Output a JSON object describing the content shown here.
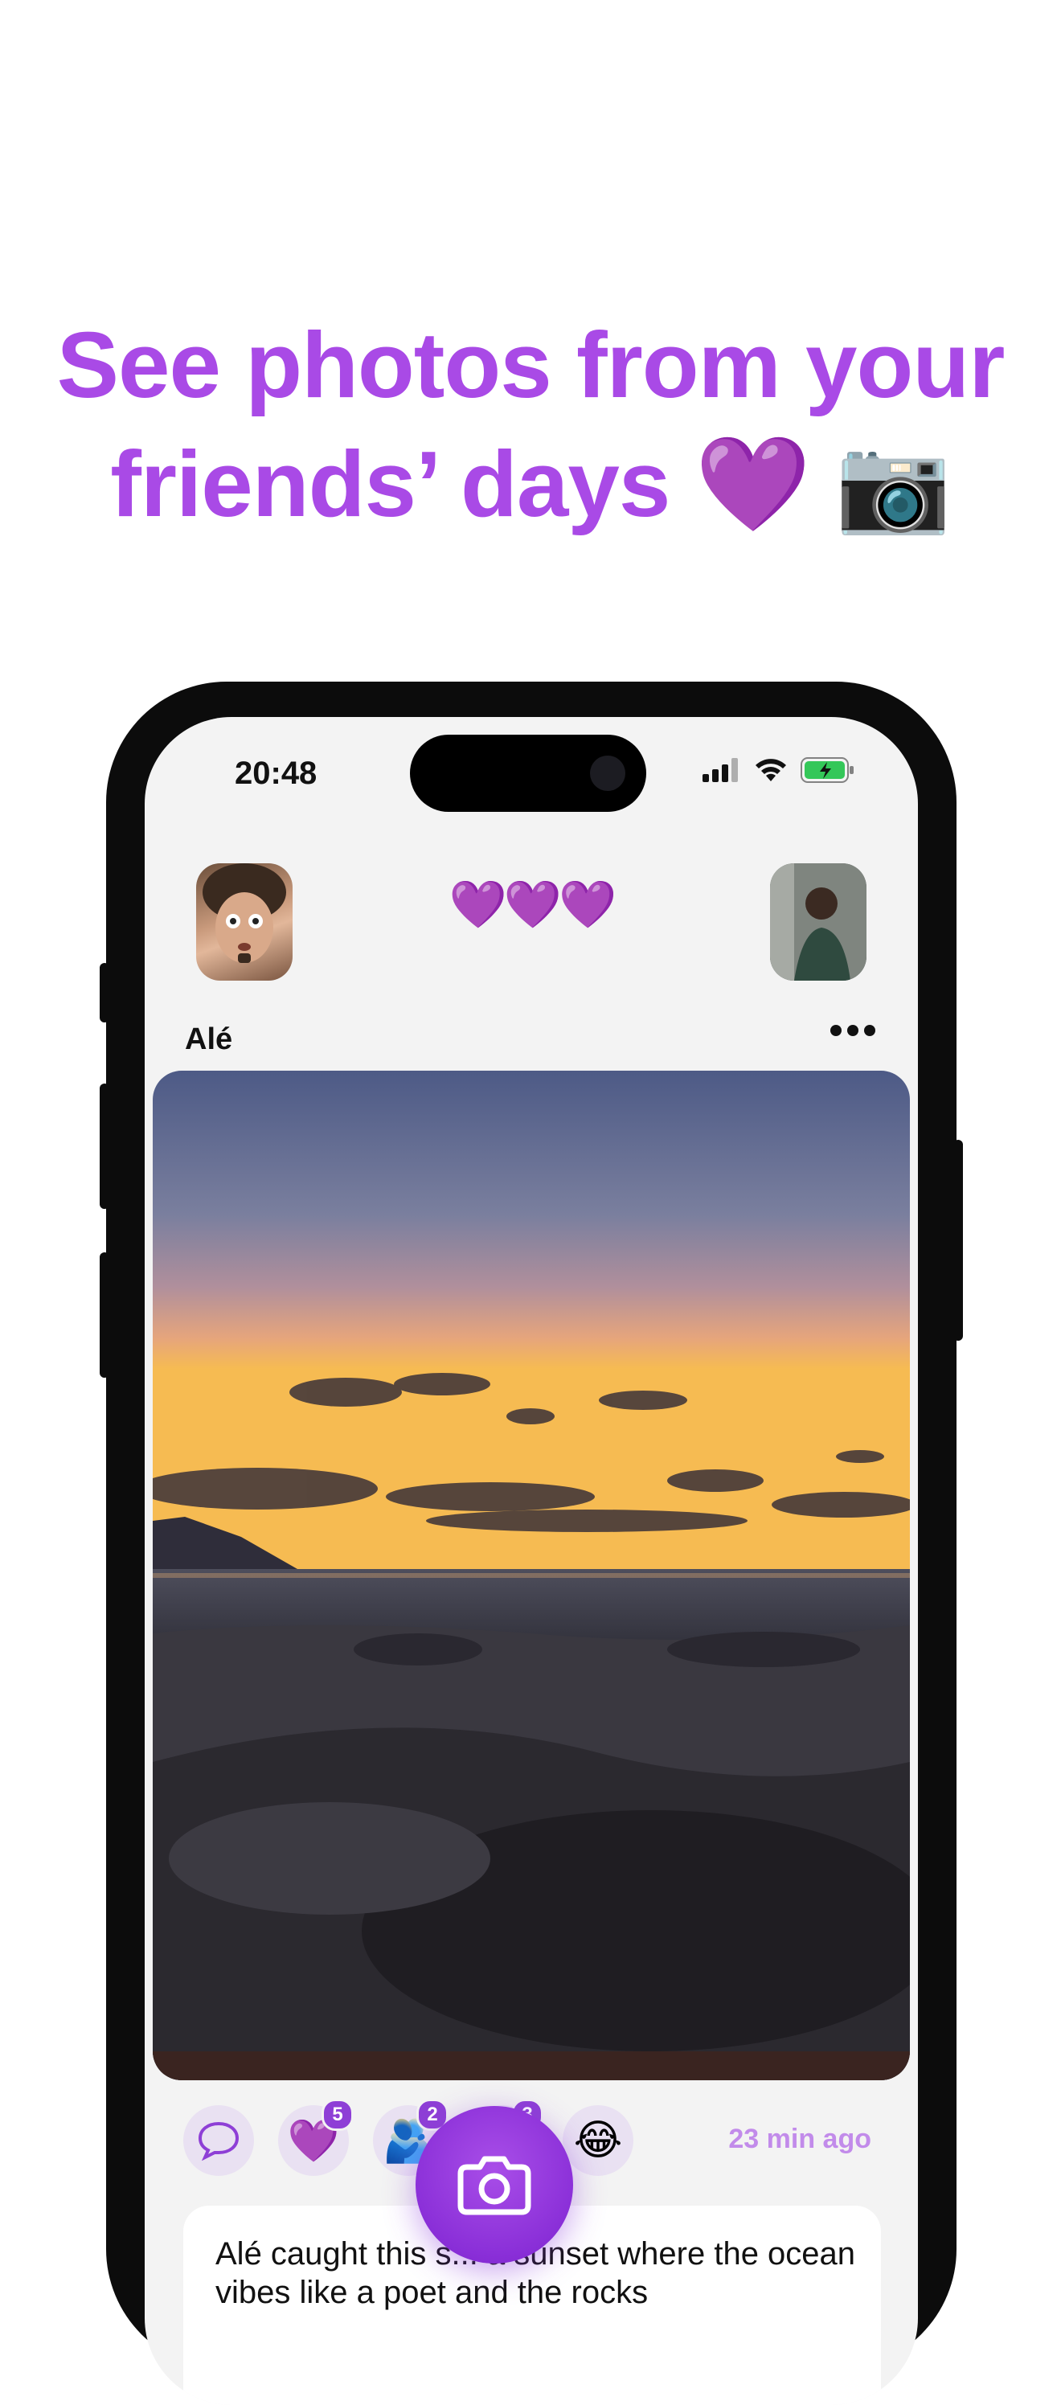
{
  "headline": {
    "line1": "See photos from your",
    "line2": "friends’ days",
    "emojis": "💜 📷"
  },
  "status_bar": {
    "time": "20:48"
  },
  "header": {
    "hearts": "💜💜💜"
  },
  "post": {
    "poster_name": "Alé",
    "time_ago": "23 min ago",
    "reactions": [
      {
        "emoji": "💬",
        "count": ""
      },
      {
        "emoji": "💜",
        "count": "5"
      },
      {
        "emoji": "🫂",
        "count": "2"
      },
      {
        "emoji": "😍",
        "count": "3"
      },
      {
        "emoji": "😂",
        "count": ""
      }
    ],
    "caption": "Alé caught this s... a sunset where the ocean vibes like a poet and the rocks"
  },
  "colors": {
    "brand_purple": "#a94ae6",
    "badge_purple": "#8e3fd6",
    "time_ago": "#c28bea"
  },
  "icons": {
    "more": "more-dots-icon",
    "camera": "camera-icon",
    "signal": "signal-icon",
    "wifi": "wifi-icon",
    "battery": "battery-charging-icon"
  }
}
